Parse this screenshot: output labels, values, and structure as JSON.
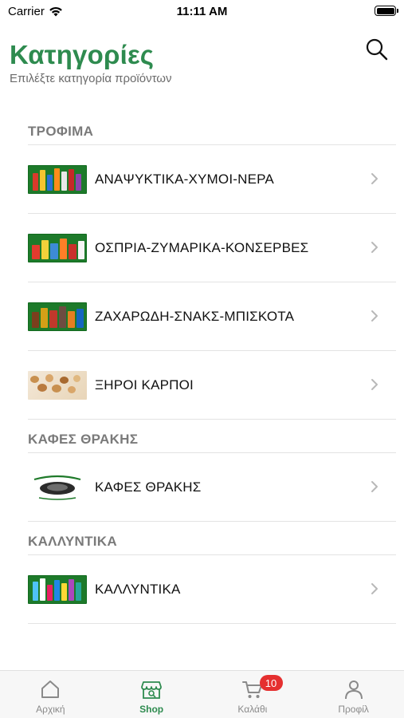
{
  "status_bar": {
    "carrier": "Carrier",
    "time": "11:11 AM"
  },
  "header": {
    "title": "Κατηγορίες",
    "subtitle": "Επιλέξτε κατηγορία προϊόντων",
    "search_icon": "search-icon"
  },
  "sections": [
    {
      "title": "ΤΡΟΦΙΜΑ",
      "items": [
        {
          "label": "ΑΝΑΨΥΚΤΙΚΑ-ΧΥΜΟΙ-ΝΕΡΑ"
        },
        {
          "label": "ΟΣΠΡΙΑ-ΖΥΜΑΡΙΚΑ-ΚΟΝΣΕΡΒΕΣ"
        },
        {
          "label": "ΖΑΧΑΡΩΔΗ-ΣΝΑΚΣ-ΜΠΙΣΚΟΤΑ"
        },
        {
          "label": "ΞΗΡΟΙ ΚΑΡΠΟΙ"
        }
      ]
    },
    {
      "title": "ΚΑΦΕΣ ΘΡΑΚΗΣ",
      "items": [
        {
          "label": "ΚΑΦΕΣ ΘΡΑΚΗΣ"
        }
      ]
    },
    {
      "title": "ΚΑΛΛΥΝΤΙΚΑ",
      "items": [
        {
          "label": "ΚΑΛΛΥΝΤΙΚΑ"
        }
      ]
    }
  ],
  "tab_bar": {
    "tabs": [
      {
        "label": "Αρχική",
        "icon": "home-icon",
        "active": false
      },
      {
        "label": "Shop",
        "icon": "shop-icon",
        "active": true
      },
      {
        "label": "Καλάθι",
        "icon": "cart-icon",
        "active": false,
        "badge": "10"
      },
      {
        "label": "Προφίλ",
        "icon": "profile-icon",
        "active": false
      }
    ]
  },
  "colors": {
    "accent": "#2e8b4f",
    "badge": "#e53030",
    "section_header": "#7a7a7a"
  }
}
